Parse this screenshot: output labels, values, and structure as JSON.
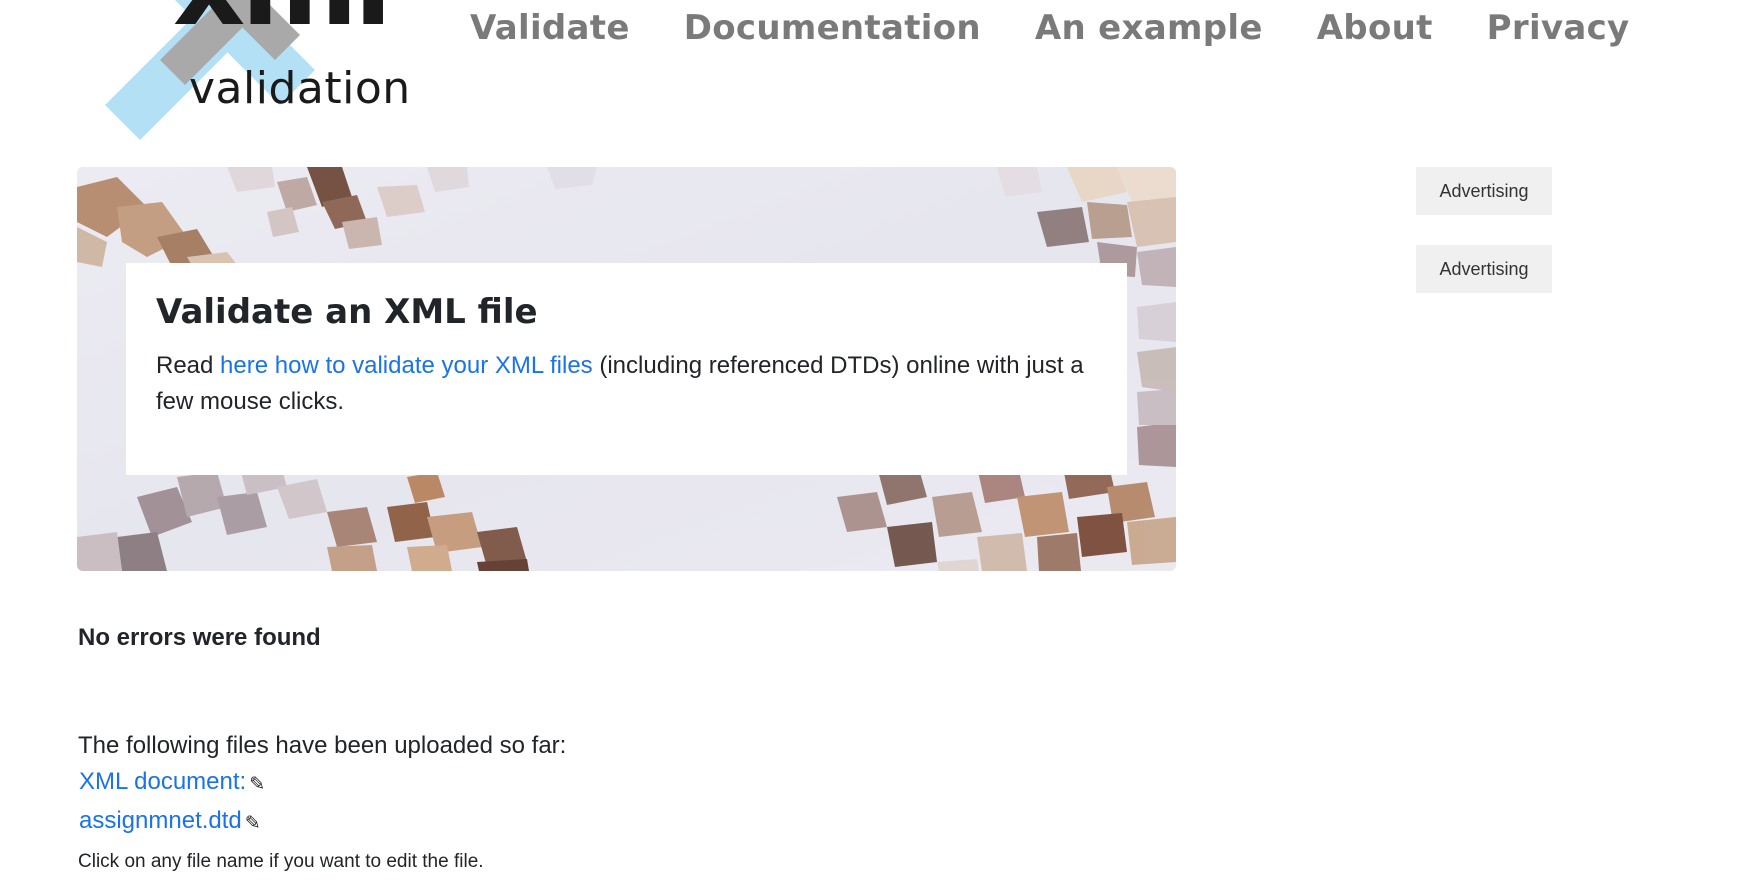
{
  "logo": {
    "mark": "xml",
    "caption": "validation"
  },
  "nav": {
    "items": [
      {
        "label": "Validate"
      },
      {
        "label": "Documentation"
      },
      {
        "label": "An example"
      },
      {
        "label": "About"
      },
      {
        "label": "Privacy"
      }
    ]
  },
  "hero": {
    "title": "Validate an XML file",
    "text_before": "Read ",
    "link_text": "here how to validate your XML files",
    "text_after": " (including referenced DTDs) online with just a few mouse clicks."
  },
  "ads": [
    {
      "label": "Advertising"
    },
    {
      "label": "Advertising"
    }
  ],
  "result": {
    "status": "No errors were found"
  },
  "uploads": {
    "intro": "The following files have been uploaded so far:",
    "files": [
      {
        "name": "XML document:",
        "icon": "pencil-icon"
      },
      {
        "name": "assignmnet.dtd",
        "icon": "pencil-icon"
      }
    ],
    "hint": "Click on any file name if you want to edit the file."
  },
  "colors": {
    "link": "#1a73e8",
    "nav": "#7a7a7a",
    "logo_blue": "#b3e0f5",
    "logo_grey": "#a9a9a9",
    "logo_dark": "#1a1a1a"
  }
}
